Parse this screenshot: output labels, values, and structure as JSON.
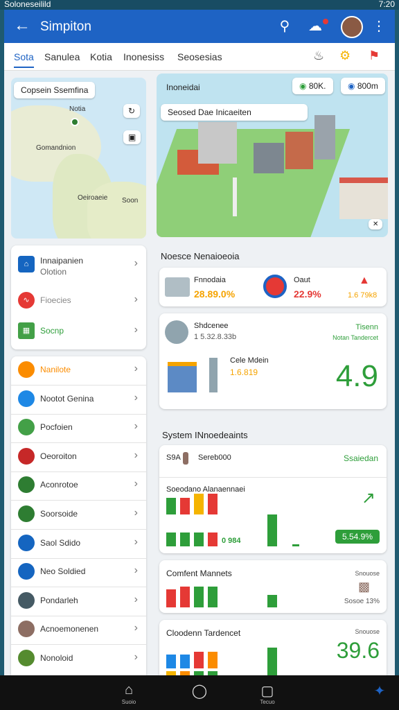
{
  "status_bar": {
    "left_text": "Soloneseilild",
    "time": "7:20"
  },
  "app_bar": {
    "title": "Simpiton"
  },
  "tabs": [
    {
      "label": "Sota",
      "active": true
    },
    {
      "label": "Sanulea"
    },
    {
      "label": "Kotia"
    },
    {
      "label": "Inonesiss"
    },
    {
      "label": "Seosesias"
    }
  ],
  "map": {
    "chip": "Copsein Ssemfina",
    "labels": [
      "Notia",
      "Gomandnion",
      "Oeiroaeie",
      "Soon"
    ]
  },
  "city": {
    "chip_label": "Inoneidai",
    "pill1": "80K.",
    "pill2": "800m",
    "search_text": "Seosed Dae Inicaeiten"
  },
  "menu_a": [
    {
      "label": "Innaipanien",
      "sub": "Olotion",
      "icon": "home-icon",
      "color": "#1565c0"
    },
    {
      "label": "Fioecies",
      "icon": "graph-icon",
      "color": "#e53935"
    },
    {
      "label": "Socnp",
      "icon": "grid-icon",
      "color": "#43a047"
    }
  ],
  "menu_b": [
    {
      "label": "Nanilote",
      "icon": "sun-icon",
      "color": "#fb8c00"
    },
    {
      "label": "Nootot Genina",
      "icon": "calendar-icon",
      "color": "#1e88e5"
    },
    {
      "label": "Pocfoien",
      "icon": "tag-icon",
      "color": "#43a047"
    },
    {
      "label": "Oeoroiton",
      "icon": "image-icon",
      "color": "#c62828"
    },
    {
      "label": "Aconrotoe",
      "icon": "building-icon",
      "color": "#2e7d32"
    },
    {
      "label": "Soorsoide",
      "icon": "landscape-icon",
      "color": "#2e7d32"
    },
    {
      "label": "Saol Sdido",
      "icon": "plane-icon",
      "color": "#1565c0"
    },
    {
      "label": "Neo Soldied",
      "icon": "city-icon",
      "color": "#1565c0"
    },
    {
      "label": "Pondarleh",
      "icon": "people-icon",
      "color": "#455a64"
    },
    {
      "label": "Acnoemonenen",
      "icon": "beach-icon",
      "color": "#8d6e63"
    },
    {
      "label": "Nonoloid",
      "icon": "palm-icon",
      "color": "#558b2f"
    }
  ],
  "section1": {
    "title": "Noesce Nenaioeoia"
  },
  "stat_card1": {
    "label_a": "Fnnodaia",
    "value_a": "28.89.0%",
    "label_b": "Oaut",
    "value_b": "22.9%",
    "value_c": "1.6 79k8"
  },
  "stat_card2": {
    "title": "Shdcenee",
    "sub": "1 5.32.8.33b",
    "right_title": "Tisenn",
    "right_sub": "Notan Tandercet",
    "mid_title": "Cele Mdein",
    "mid_value": "1.6.819",
    "big": "4.9"
  },
  "section2": {
    "title": "System INnoedeaints"
  },
  "sys_card1": {
    "id": "S9A",
    "value": "Sereb000",
    "right": "Ssaiedan",
    "subtitle": "Soeodano Alanaennaei",
    "badge_left": "0 984",
    "badge": "5.54.9%"
  },
  "sys_card2": {
    "title": "Comfent Mannets",
    "right_a": "Snouose",
    "right_b": "Sosoe 13%"
  },
  "sys_card3": {
    "title": "Cloodenn Tardencet",
    "right": "Snouose",
    "big": "39.6"
  },
  "nav": {
    "home": "Suoio",
    "recent": "Tecuo"
  },
  "colors": {
    "primary": "#1e63c4",
    "green": "#2e9e3a",
    "red": "#e53935",
    "orange": "#fb8c00"
  }
}
